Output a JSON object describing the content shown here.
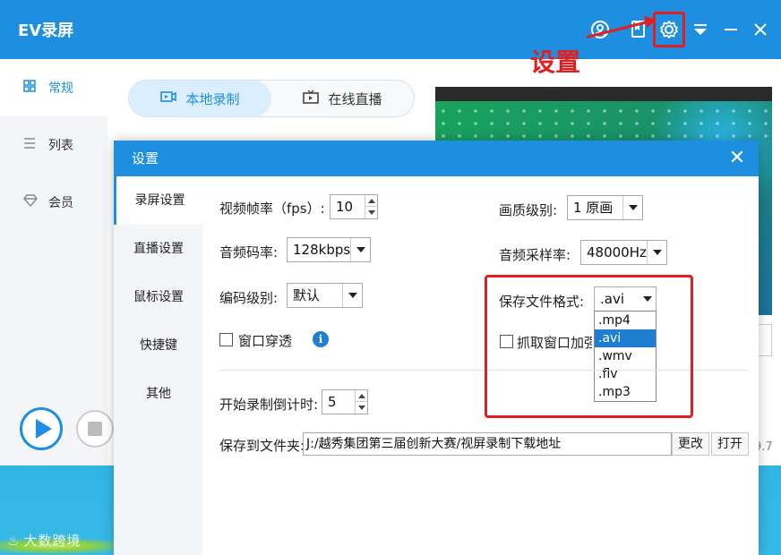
{
  "desktop": {
    "watermark": "大数跨境",
    "watermark_logo": "♨"
  },
  "app": {
    "title": "EV录屏",
    "version": "9.7",
    "annotation": "设置",
    "colors": {
      "accent": "#1e8fe0",
      "annotation": "#e02020"
    }
  },
  "toolbar": {
    "icons": [
      "user-icon",
      "bookmark-icon",
      "gear-icon",
      "dropdown-icon",
      "minimize-icon",
      "close-icon"
    ]
  },
  "sidebar": {
    "items": [
      {
        "label": "常规",
        "icon": "grid-icon"
      },
      {
        "label": "列表",
        "icon": "list-icon"
      },
      {
        "label": "会员",
        "icon": "diamond-icon"
      }
    ]
  },
  "tabs": [
    {
      "label": "本地录制",
      "active": true
    },
    {
      "label": "在线直播",
      "active": false
    }
  ],
  "dialog": {
    "title": "设置",
    "close": "✕",
    "side": [
      "录屏设置",
      "直播设置",
      "鼠标设置",
      "快捷键",
      "其他"
    ],
    "fps_label": "视频帧率（fps）:",
    "fps_value": "10",
    "audio_bitrate_label": "音频码率:",
    "audio_bitrate_value": "128kbps",
    "encoding_label": "编码级别:",
    "encoding_value": "默认",
    "window_through_label": "窗口穿透",
    "quality_label": "画质级别:",
    "quality_value": "1 原画",
    "sample_rate_label": "音频采样率:",
    "sample_rate_value": "48000Hz",
    "format_label": "保存文件格式:",
    "format_value": ".avi",
    "format_options": [
      ".mp4",
      ".avi",
      ".wmv",
      ".flv",
      ".mp3"
    ],
    "format_selected_index": 1,
    "capture_window_label": "抓取窗口加强",
    "countdown_label": "开始录制倒计时:",
    "countdown_value": "5",
    "save_folder_label": "保存到文件夹:",
    "save_folder_value": "J:/越秀集团第三届创新大赛/视屏录制下载地址",
    "change_button": "更改",
    "open_button": "打开"
  }
}
